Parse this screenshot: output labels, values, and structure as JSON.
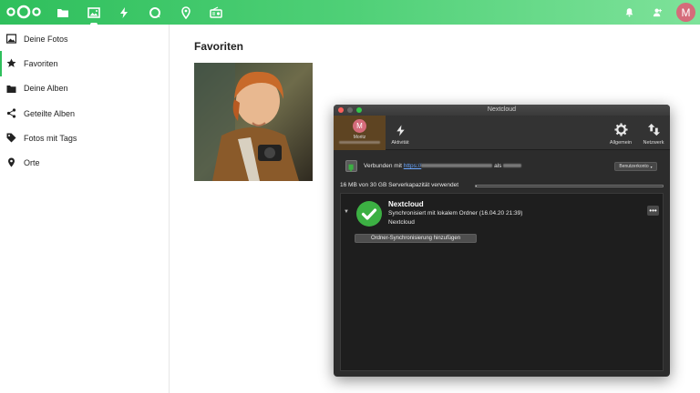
{
  "topbar": {
    "apps": [
      {
        "name": "files-icon"
      },
      {
        "name": "photos-icon"
      },
      {
        "name": "activity-icon"
      },
      {
        "name": "talk-icon"
      },
      {
        "name": "maps-icon"
      },
      {
        "name": "radio-icon"
      }
    ],
    "active_app": "photos",
    "avatar_letter": "M",
    "accent": "#2fbf5c"
  },
  "sidebar": {
    "items": [
      {
        "label": "Deine Fotos",
        "icon": "image-icon"
      },
      {
        "label": "Favoriten",
        "icon": "star-icon"
      },
      {
        "label": "Deine Alben",
        "icon": "folder-icon"
      },
      {
        "label": "Geteilte Alben",
        "icon": "share-icon"
      },
      {
        "label": "Fotos mit Tags",
        "icon": "tag-icon"
      },
      {
        "label": "Orte",
        "icon": "location-icon"
      }
    ],
    "active_index": 1
  },
  "main": {
    "title": "Favoriten"
  },
  "nextcloud_window": {
    "title": "Nextcloud",
    "account": {
      "avatar_letter": "M",
      "name": "Moritz"
    },
    "toolbar": {
      "activity_label": "Aktivität",
      "general_label": "Allgemein",
      "network_label": "Netzwerk"
    },
    "connection": {
      "prefix": "Verbunden mit",
      "link": "https://",
      "infix": "als"
    },
    "account_dropdown": "Benutzerkonto",
    "quota": {
      "text": "16 MB von 30 GB Serverkapazität verwendet",
      "used_fraction": 0.0005
    },
    "folder": {
      "name": "Nextcloud",
      "status": "Synchronisiert mit lokalem Ordner (16.04.20 21:39)",
      "subtitle": "Nextcloud"
    },
    "add_sync_button": "Ordner-Synchronisierung hinzufügen"
  }
}
